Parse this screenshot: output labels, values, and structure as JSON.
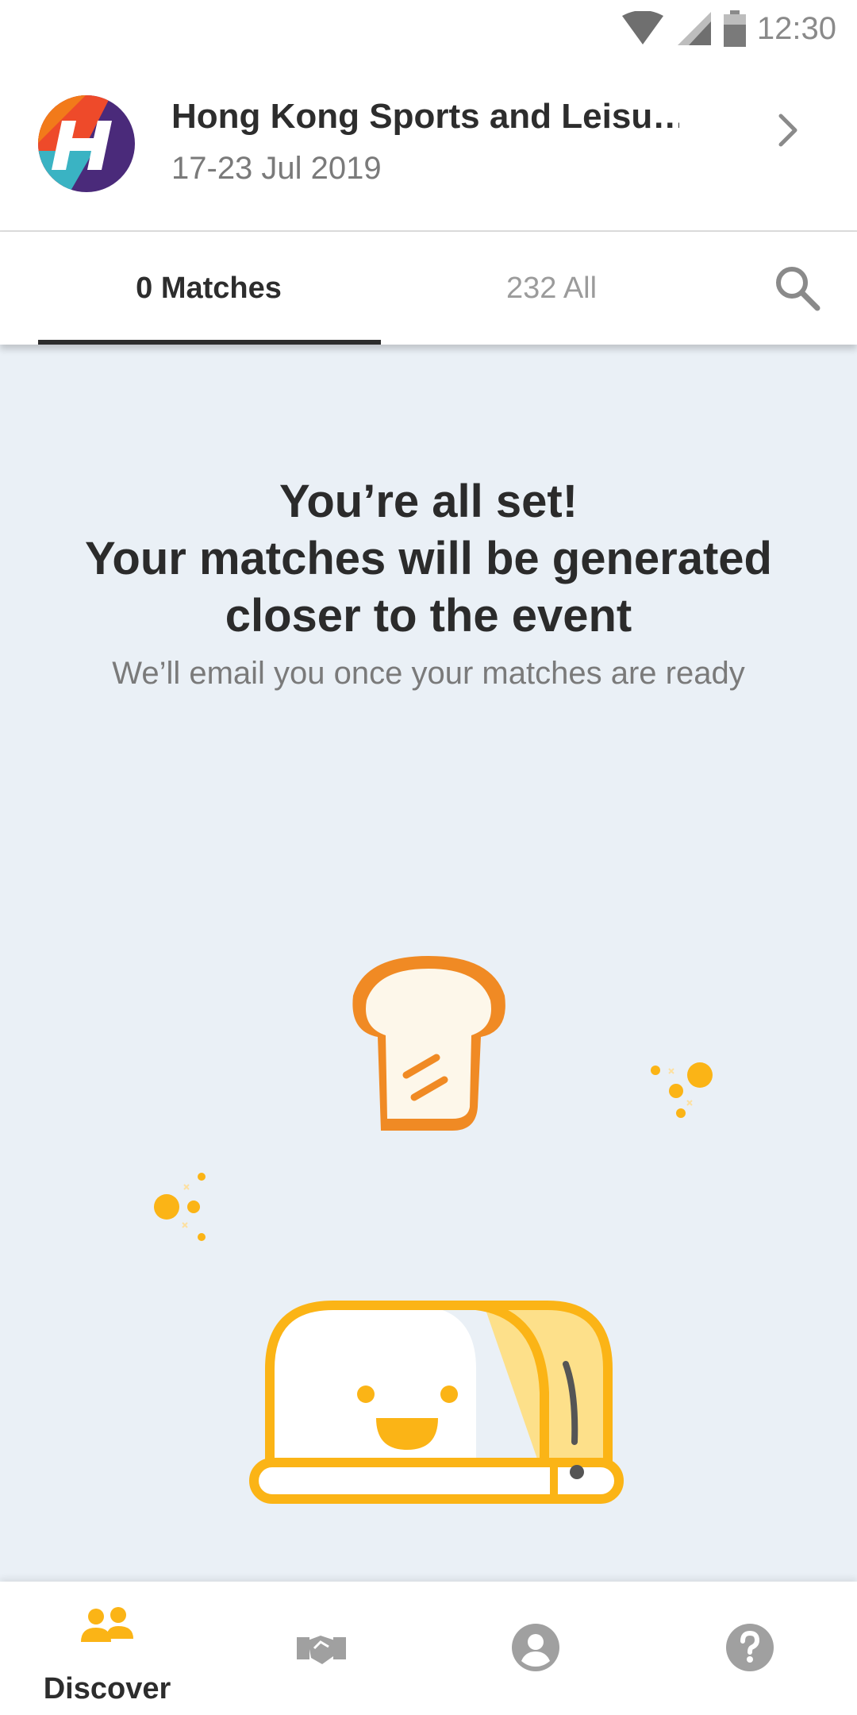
{
  "status": {
    "time": "12:30"
  },
  "event": {
    "title": "Hong Kong Sports and Leisu…",
    "date": "17-23 Jul 2019"
  },
  "tabs": {
    "matches_label": "0 Matches",
    "all_label": "232 All"
  },
  "empty_state": {
    "title_line1": "You’re all set!",
    "title_line2": "Your matches will be generated",
    "title_line3": "closer to the event",
    "subtitle": "We’ll email you once your matches are ready"
  },
  "bottom_nav": {
    "discover_label": "Discover",
    "items": [
      "discover-icon",
      "handshake-icon",
      "profile-icon",
      "help-icon"
    ]
  },
  "colors": {
    "accent": "#fbb416",
    "toast_orange": "#f08a24",
    "text_dark": "#2d2d2d",
    "text_muted": "#7a7a7a",
    "background": "#eaf0f6"
  }
}
